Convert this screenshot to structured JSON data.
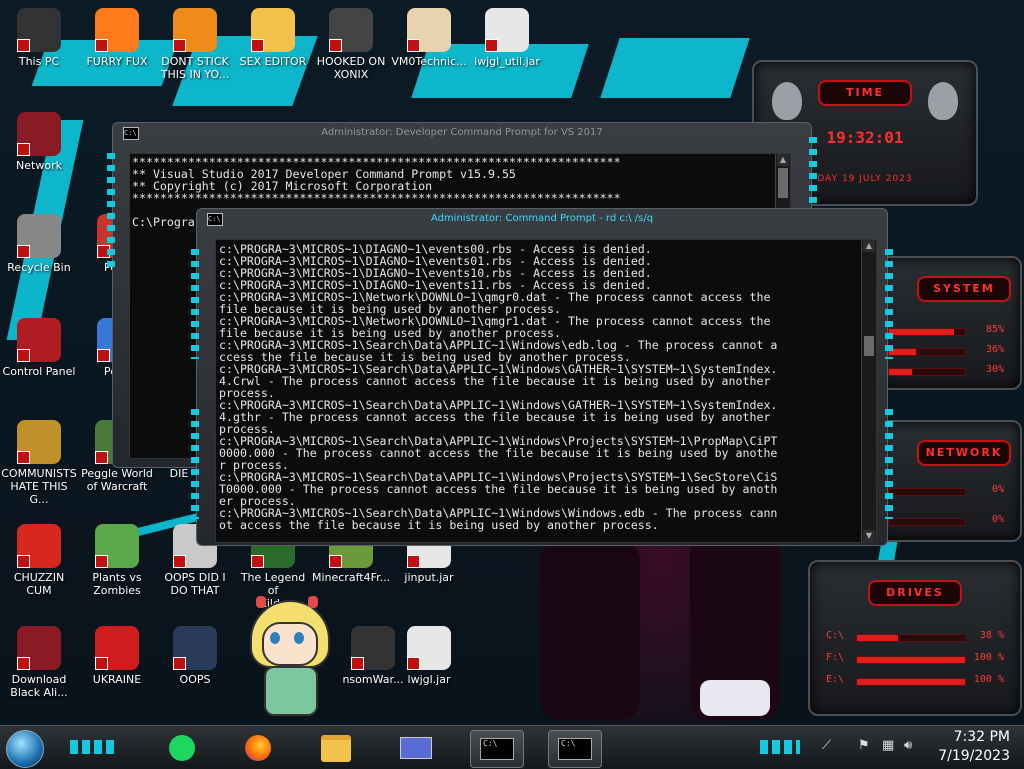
{
  "desktop": {
    "icons": [
      {
        "id": "this-pc",
        "label": "This PC"
      },
      {
        "id": "furry-fux",
        "label": "FURRY FUX"
      },
      {
        "id": "dont-stick",
        "label": "DONT STICK\nTHIS IN YO..."
      },
      {
        "id": "sex-editor",
        "label": "SEX EDITOR"
      },
      {
        "id": "hooked-on-xonix",
        "label": "HOOKED ON\nXONIX"
      },
      {
        "id": "vm0",
        "label": "VM0Technic..."
      },
      {
        "id": "lwjgl-util",
        "label": "lwjgl_util.jar"
      },
      {
        "id": "network",
        "label": "Network"
      },
      {
        "id": "recycle-bin",
        "label": "Recycle Bin"
      },
      {
        "id": "peggle",
        "label": "Peggl"
      },
      {
        "id": "control-panel",
        "label": "Control Panel"
      },
      {
        "id": "peggle2",
        "label": "Peggl"
      },
      {
        "id": "communists",
        "label": "COMMUNISTS\nHATE THIS G..."
      },
      {
        "id": "peggle-wow",
        "label": "Peggle World\nof Warcraft"
      },
      {
        "id": "die",
        "label": "DIE"
      },
      {
        "id": "chuzzin",
        "label": "CHUZZIN\nCUM"
      },
      {
        "id": "pvz",
        "label": "Plants vs\nZombies"
      },
      {
        "id": "oops-did",
        "label": "OOPS DID I\nDO THAT"
      },
      {
        "id": "legend-zilda",
        "label": "The Legend of\nZilda"
      },
      {
        "id": "minecraft",
        "label": "Minecraft4Fr..."
      },
      {
        "id": "jinput",
        "label": "jinput.jar"
      },
      {
        "id": "download-black",
        "label": "Download\nBlack Ali..."
      },
      {
        "id": "ukraine",
        "label": "UKRAINE"
      },
      {
        "id": "oops",
        "label": "OOPS"
      },
      {
        "id": "ransomware",
        "label": "nsomWar..."
      },
      {
        "id": "lwjgl",
        "label": "lwjgl.jar"
      }
    ]
  },
  "widgets": {
    "time": {
      "title": "TIME",
      "clock": "19:32:01",
      "date": "DAY 19 JULY 2023"
    },
    "system": {
      "title": "SYSTEM",
      "rows": [
        {
          "label": "",
          "pct": "85%",
          "value": 0.85
        },
        {
          "label": "",
          "pct": "36%",
          "value": 0.36
        },
        {
          "label": "",
          "pct": "30%",
          "value": 0.3
        }
      ]
    },
    "network": {
      "title": "NETWORK",
      "rows": [
        {
          "label": "",
          "pct": "0%",
          "value": 0.0
        },
        {
          "label": "",
          "pct": "0%",
          "value": 0.0
        }
      ]
    },
    "drives": {
      "title": "DRIVES",
      "rows": [
        {
          "label": "C:\\",
          "pct": "38 %",
          "value": 0.38
        },
        {
          "label": "F:\\",
          "pct": "100 %",
          "value": 1.0
        },
        {
          "label": "E:\\",
          "pct": "100 %",
          "value": 1.0
        }
      ]
    }
  },
  "vs_prompt": {
    "title": "Administrator: Developer Command Prompt for VS 2017",
    "lines": [
      "**********************************************************************",
      "** Visual Studio 2017 Developer Command Prompt v15.9.55",
      "** Copyright (c) 2017 Microsoft Corporation",
      "**********************************************************************",
      "",
      "C:\\Progra"
    ]
  },
  "cmd_prompt": {
    "title": "Administrator: Command Prompt - rd c:\\ /s/q",
    "lines": [
      "c:\\PROGRA~3\\MICROS~1\\DIAGNO~1\\events00.rbs - Access is denied.",
      "c:\\PROGRA~3\\MICROS~1\\DIAGNO~1\\events01.rbs - Access is denied.",
      "c:\\PROGRA~3\\MICROS~1\\DIAGNO~1\\events10.rbs - Access is denied.",
      "c:\\PROGRA~3\\MICROS~1\\DIAGNO~1\\events11.rbs - Access is denied.",
      "c:\\PROGRA~3\\MICROS~1\\Network\\DOWNLO~1\\qmgr0.dat - The process cannot access the",
      "file because it is being used by another process.",
      "c:\\PROGRA~3\\MICROS~1\\Network\\DOWNLO~1\\qmgr1.dat - The process cannot access the",
      "file because it is being used by another process.",
      "c:\\PROGRA~3\\MICROS~1\\Search\\Data\\APPLIC~1\\Windows\\edb.log - The process cannot a",
      "ccess the file because it is being used by another process.",
      "c:\\PROGRA~3\\MICROS~1\\Search\\Data\\APPLIC~1\\Windows\\GATHER~1\\SYSTEM~1\\SystemIndex.",
      "4.Crwl - The process cannot access the file because it is being used by another",
      "process.",
      "c:\\PROGRA~3\\MICROS~1\\Search\\Data\\APPLIC~1\\Windows\\GATHER~1\\SYSTEM~1\\SystemIndex.",
      "4.gthr - The process cannot access the file because it is being used by another",
      "process.",
      "c:\\PROGRA~3\\MICROS~1\\Search\\Data\\APPLIC~1\\Windows\\Projects\\SYSTEM~1\\PropMap\\CiPT",
      "0000.000 - The process cannot access the file because it is being used by anothe",
      "r process.",
      "c:\\PROGRA~3\\MICROS~1\\Search\\Data\\APPLIC~1\\Windows\\Projects\\SYSTEM~1\\SecStore\\CiS",
      "T0000.000 - The process cannot access the file because it is being used by anoth",
      "er process.",
      "c:\\PROGRA~3\\MICROS~1\\Search\\Data\\APPLIC~1\\Windows\\Windows.edb - The process cann",
      "ot access the file because it is being used by another process."
    ]
  },
  "taskbar": {
    "clock_time": "7:32 PM",
    "clock_date": "7/19/2023",
    "console_label": "C:\\"
  },
  "colors": {
    "accent_cyan": "#0ec3d9",
    "alien_red": "#e11c1c"
  }
}
